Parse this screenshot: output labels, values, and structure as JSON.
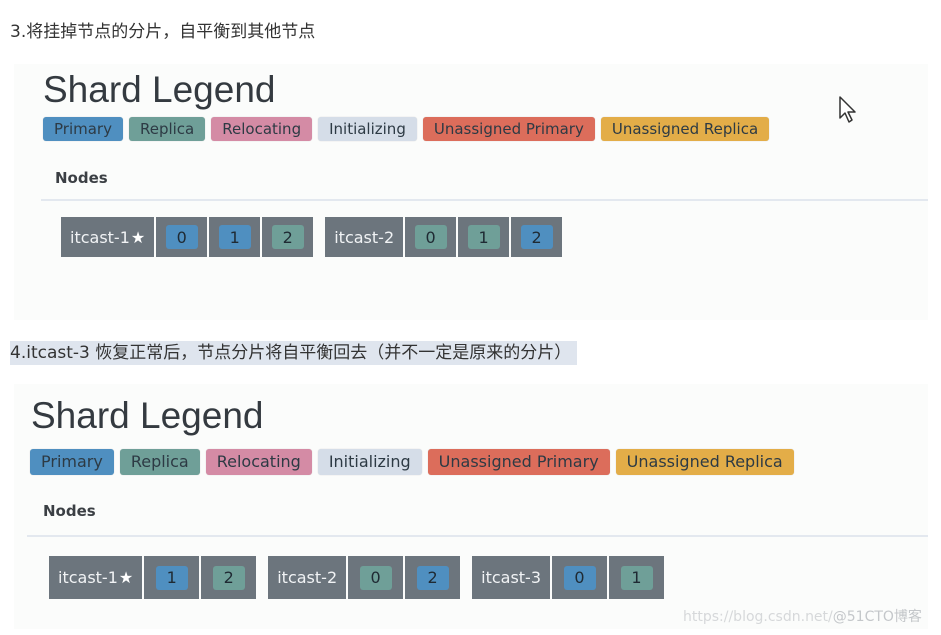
{
  "captions": {
    "step3": "3.将挂掉节点的分片，自平衡到其他节点",
    "step4": "4.itcast-3 恢复正常后，节点分片将自平衡回去（并不一定是原来的分片）"
  },
  "colors": {
    "primary": "#4f8fc0",
    "replica": "#6f9f98",
    "relocating": "#d48ba5",
    "initializing": "#d5dde8",
    "unassigned_primary": "#dc6d5b",
    "unassigned_replica": "#e3ad48",
    "node_bg": "#6c757d"
  },
  "legend": {
    "title": "Shard Legend",
    "items": [
      {
        "label": "Primary",
        "key": "primary"
      },
      {
        "label": "Replica",
        "key": "replica"
      },
      {
        "label": "Relocating",
        "key": "relocating"
      },
      {
        "label": "Initializing",
        "key": "initializing"
      },
      {
        "label": "Unassigned Primary",
        "key": "unassigned_primary"
      },
      {
        "label": "Unassigned Replica",
        "key": "unassigned_replica"
      }
    ]
  },
  "nodes_label": "Nodes",
  "panel1": {
    "nodes": [
      {
        "name": "itcast-1",
        "master": true,
        "star_icon": "★",
        "shards": [
          {
            "id": "0",
            "type": "primary"
          },
          {
            "id": "1",
            "type": "primary"
          },
          {
            "id": "2",
            "type": "replica"
          }
        ]
      },
      {
        "name": "itcast-2",
        "master": false,
        "shards": [
          {
            "id": "0",
            "type": "replica"
          },
          {
            "id": "1",
            "type": "replica"
          },
          {
            "id": "2",
            "type": "primary"
          }
        ]
      }
    ]
  },
  "panel2": {
    "nodes": [
      {
        "name": "itcast-1",
        "master": true,
        "star_icon": "★",
        "shards": [
          {
            "id": "1",
            "type": "primary"
          },
          {
            "id": "2",
            "type": "replica"
          }
        ]
      },
      {
        "name": "itcast-2",
        "master": false,
        "shards": [
          {
            "id": "0",
            "type": "replica"
          },
          {
            "id": "2",
            "type": "primary"
          }
        ]
      },
      {
        "name": "itcast-3",
        "master": false,
        "shards": [
          {
            "id": "0",
            "type": "primary"
          },
          {
            "id": "1",
            "type": "replica"
          }
        ]
      }
    ]
  },
  "watermark": {
    "url": "https://blog.csdn.net/",
    "brand": "@51CTO博客"
  }
}
